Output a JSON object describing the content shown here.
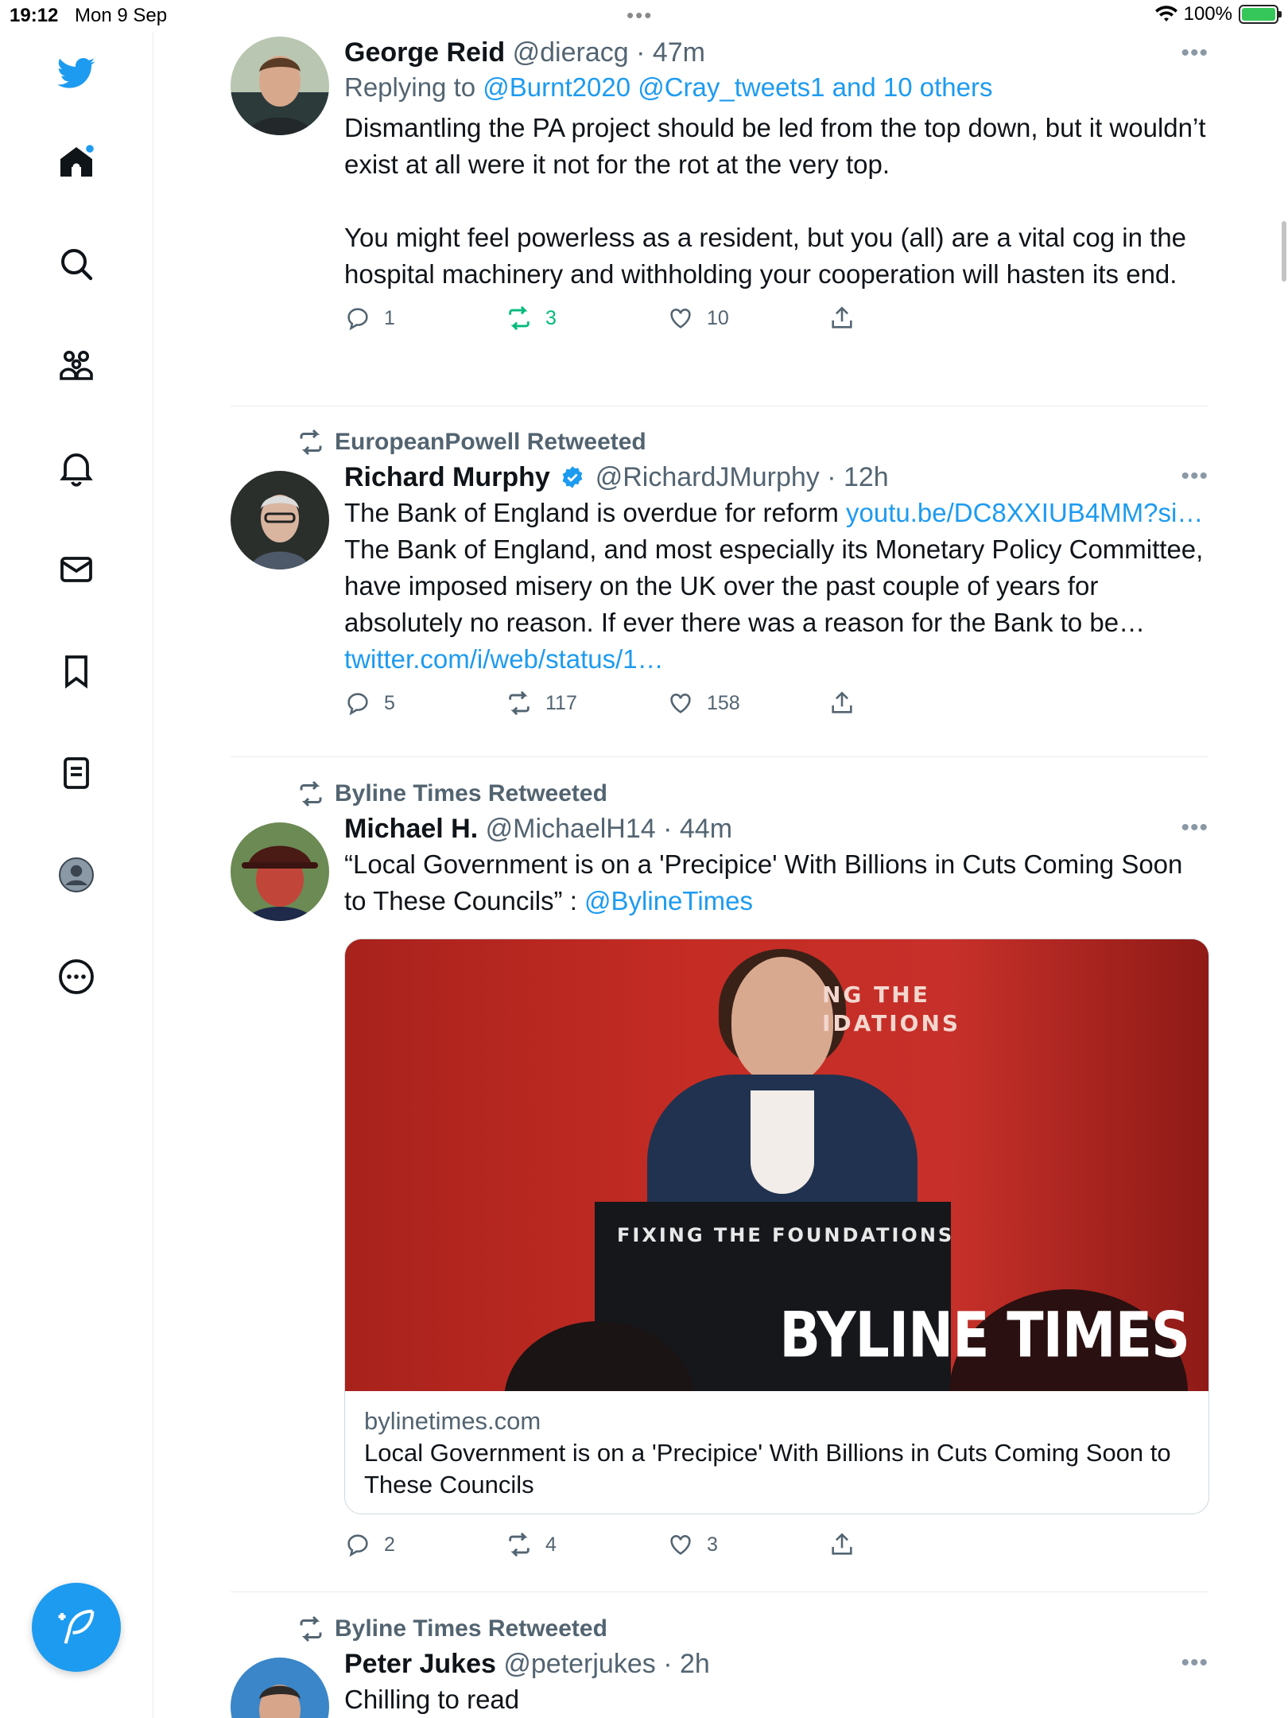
{
  "status_bar": {
    "time": "19:12",
    "date": "Mon 9 Sep",
    "dots": "•••",
    "battery": "100%"
  },
  "sidebar": {
    "items": [
      "home",
      "explore",
      "communities",
      "notifications",
      "messages",
      "bookmarks",
      "lists",
      "profile",
      "more"
    ]
  },
  "tweets": [
    {
      "name": "George Reid",
      "meta": "@dieracg · 47m",
      "reply_prefix": "Replying to ",
      "reply_targets": "@Burnt2020 @Cray_tweets1 and 10 others",
      "body_p1": "Dismantling the PA project should be led from the top down, but it wouldn’t exist at all were it not for the rot at the very top.",
      "body_p2": "You might feel powerless as a resident, but you (all) are a vital cog in the hospital machinery and withholding your cooperation will hasten its end.",
      "replies": "1",
      "retweets": "3",
      "likes": "10"
    },
    {
      "retweeted_by": "EuropeanPowell Retweeted",
      "name": "Richard Murphy",
      "meta": "@RichardJMurphy · 12h",
      "body_text1": "The Bank of England is overdue for reform ",
      "body_link1": "youtu.be/DC8XXIUB4MM?si…",
      "body_text2": " The Bank of England, and most especially its Monetary Policy Committee, have imposed misery on the UK over the past couple of years for absolutely no reason. If ever there was a reason for the Bank to be… ",
      "body_link2": "twitter.com/i/web/status/1…",
      "replies": "5",
      "retweets": "117",
      "likes": "158"
    },
    {
      "retweeted_by": "Byline Times Retweeted",
      "name": "Michael H.",
      "meta": "@MichaelH14 · 44m",
      "body_text": "“Local Government is on a 'Precipice' With Billions in Cuts Coming Soon to These Councils” : ",
      "body_link": "@BylineTimes",
      "card": {
        "image_text_top": "NG THE\nIDATIONS",
        "podium_text": "FIXING THE FOUNDATIONS",
        "brand": "BYLINE TIMES",
        "domain": "bylinetimes.com",
        "title": "Local Government is on a 'Precipice' With Billions in Cuts Coming Soon to These Councils"
      },
      "replies": "2",
      "retweets": "4",
      "likes": "3"
    },
    {
      "retweeted_by": "Byline Times Retweeted",
      "name": "Peter Jukes",
      "meta": "@peterjukes · 2h",
      "body_text": "Chilling to read"
    }
  ],
  "colors": {
    "accent": "#1d9bf0",
    "retweet_green": "#00ba7c",
    "muted": "#536471"
  }
}
